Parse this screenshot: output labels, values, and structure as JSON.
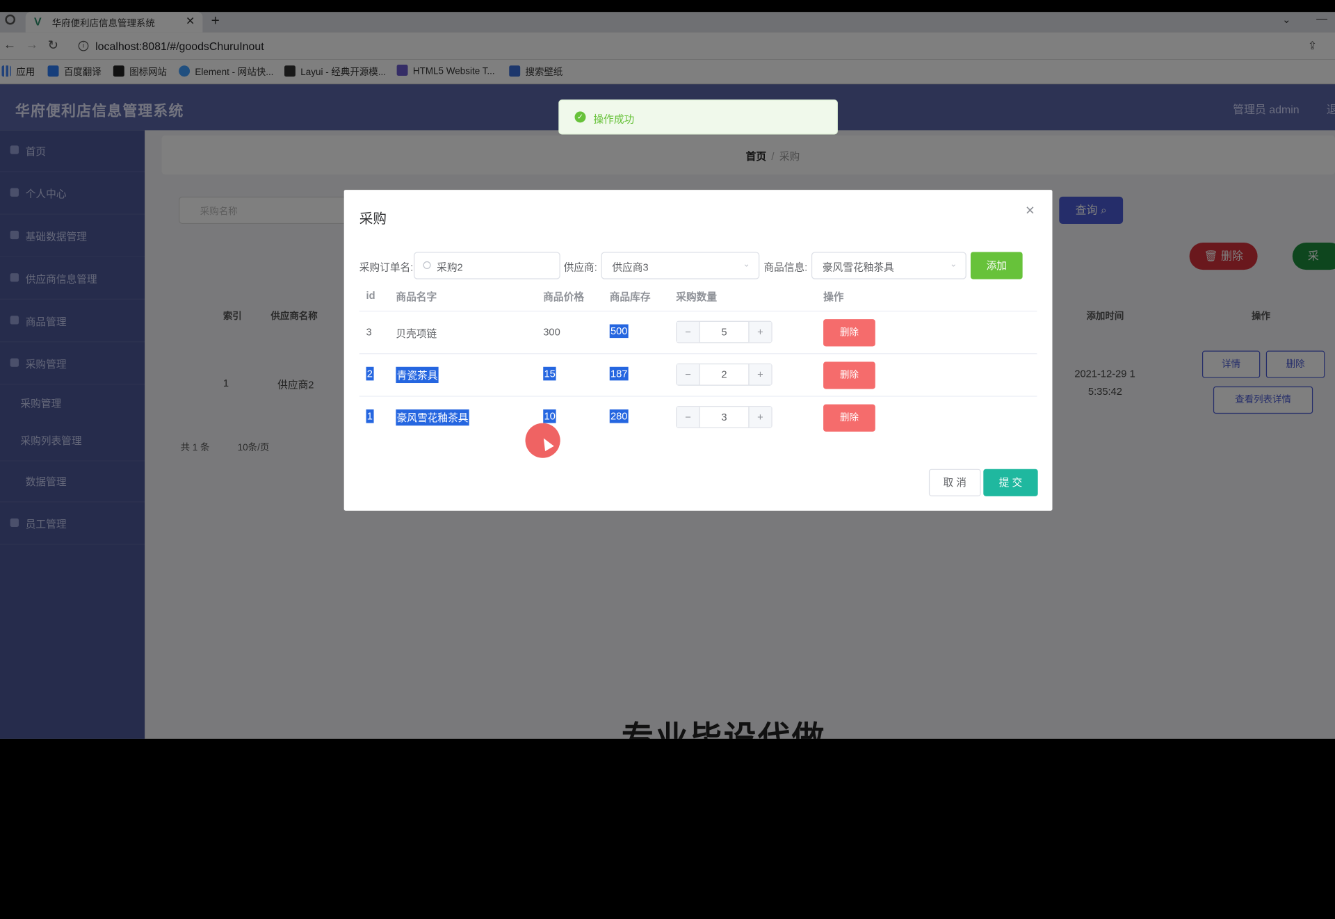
{
  "browser": {
    "tab_title": "华府便利店信息管理系统",
    "url": "localhost:8081/#/goodsChuruInout",
    "bookmarks": [
      "应用",
      "百度翻译",
      "图标网站",
      "Element - 网站快...",
      "Layui - 经典开源模...",
      "HTML5 Website T...",
      "搜索壁纸"
    ]
  },
  "app": {
    "title": "华府便利店信息管理系统",
    "admin_label": "管理员 admin",
    "admin_exit": "退",
    "sidebar": [
      "首页",
      "个人中心",
      "基础数据管理",
      "供应商信息管理",
      "商品管理",
      "采购管理",
      "采购管理",
      "采购列表管理",
      "数据管理",
      "员工管理"
    ],
    "breadcrumb": {
      "home": "首页",
      "sep": "/",
      "current": "采购"
    },
    "search_placeholder": "采购名称",
    "query_button": "查询",
    "delete_button": "删除",
    "add_button": "采",
    "table_headers": [
      "索引",
      "供应商名称",
      "添加时间",
      "操作"
    ],
    "row": {
      "index": "1",
      "supplier": "供应商2",
      "time_line1": "2021-12-29 1",
      "time_line2": "5:35:42"
    },
    "row_buttons": [
      "详情",
      "删除",
      "查看列表详情"
    ],
    "pager": {
      "total": "共 1 条",
      "size": "10条/页"
    }
  },
  "toast": {
    "text": "操作成功"
  },
  "dialog": {
    "title": "采购",
    "labels": {
      "order": "采购订单名:",
      "supplier": "供应商:",
      "goods": "商品信息:"
    },
    "order_value": "采购2",
    "supplier_value": "供应商3",
    "goods_value": "豪风雪花釉茶具",
    "add_label": "添加",
    "headers": [
      "id",
      "商品名字",
      "商品价格",
      "商品库存",
      "采购数量",
      "操作"
    ],
    "rows": [
      {
        "id": "3",
        "name": "贝壳项链",
        "price": "300",
        "stock": "500",
        "qty": "5",
        "action": "删除"
      },
      {
        "id": "2",
        "name": "青瓷茶具",
        "price": "15",
        "stock": "187",
        "qty": "2",
        "action": "删除"
      },
      {
        "id": "1",
        "name": "豪风雪花釉茶具",
        "price": "10",
        "stock": "280",
        "qty": "3",
        "action": "删除"
      }
    ],
    "cancel_label": "取 消",
    "submit_label": "提 交"
  },
  "subtitle": "专业毕设代做",
  "colors": {
    "header": "#5a67a8",
    "sidebar": "#4c5899",
    "success": "#67c23a",
    "danger": "#f56c6c",
    "submit": "#1fb89f"
  }
}
